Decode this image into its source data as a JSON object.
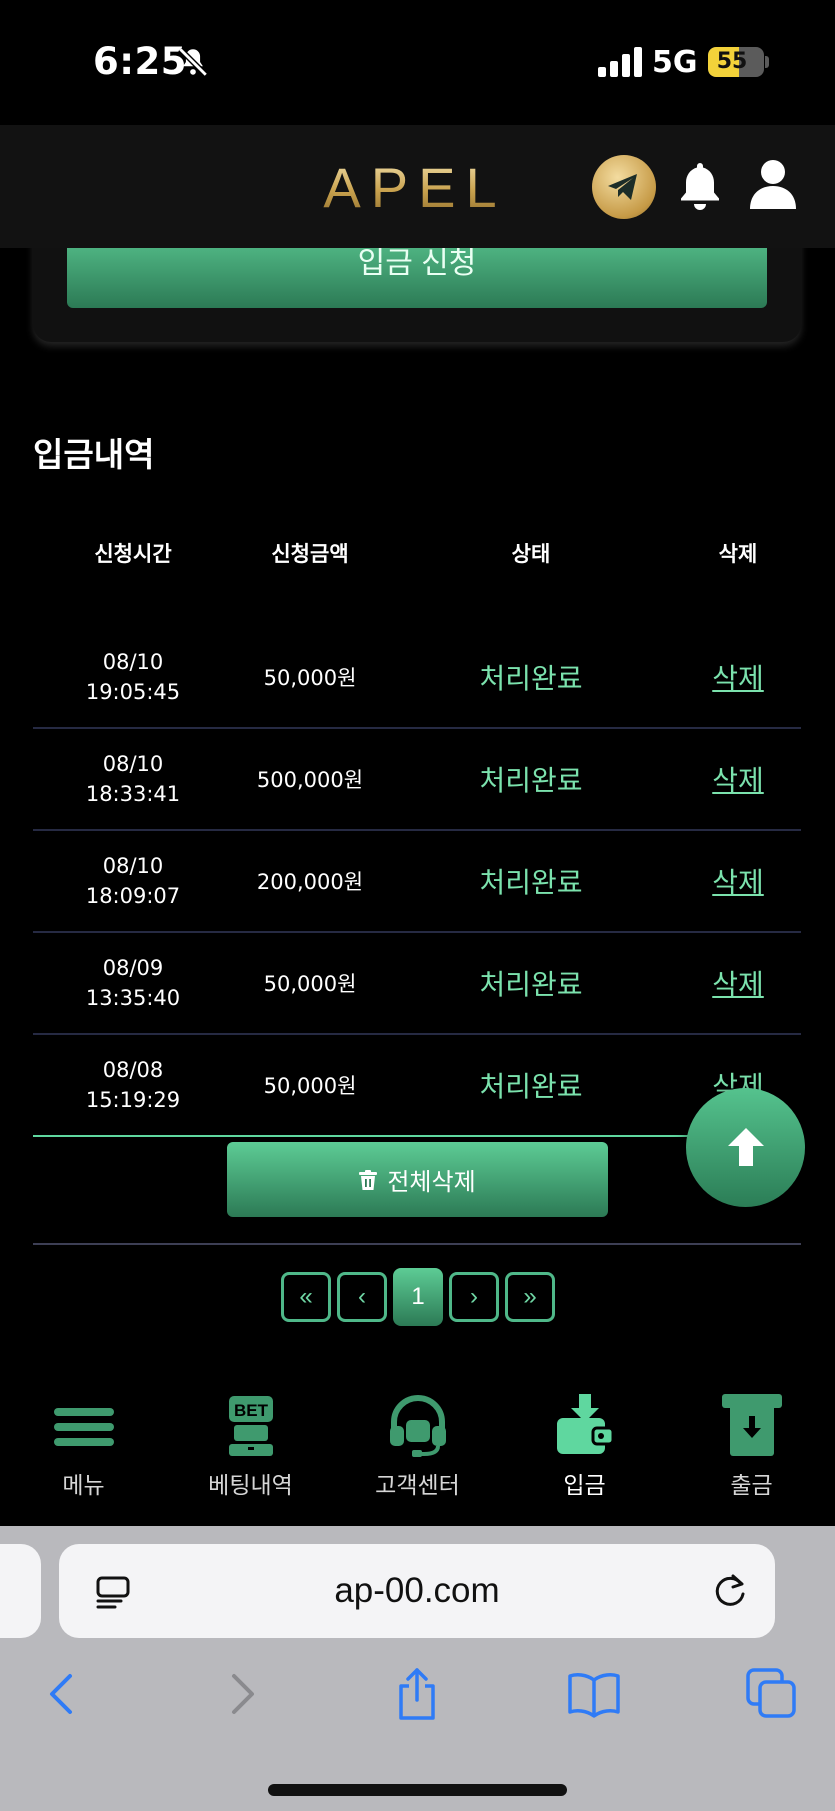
{
  "status_bar": {
    "time": "6:25",
    "network": "5G",
    "battery": "55",
    "battery_level": 0.55
  },
  "header": {
    "brand": "APEL"
  },
  "apply_button_label": "입금 신청",
  "section_title": "입금내역",
  "table": {
    "columns": [
      "신청시간",
      "신청금액",
      "상태",
      "삭제"
    ],
    "rows": [
      {
        "date": "08/10",
        "time": "19:05:45",
        "amount": "50,000원",
        "status": "처리완료",
        "action": "삭제"
      },
      {
        "date": "08/10",
        "time": "18:33:41",
        "amount": "500,000원",
        "status": "처리완료",
        "action": "삭제"
      },
      {
        "date": "08/10",
        "time": "18:09:07",
        "amount": "200,000원",
        "status": "처리완료",
        "action": "삭제"
      },
      {
        "date": "08/09",
        "time": "13:35:40",
        "amount": "50,000원",
        "status": "처리완료",
        "action": "삭제"
      },
      {
        "date": "08/08",
        "time": "15:19:29",
        "amount": "50,000원",
        "status": "처리완료",
        "action": "삭제"
      }
    ]
  },
  "delete_all_label": "전체삭제",
  "pagination": {
    "first": "«",
    "prev": "‹",
    "current": "1",
    "next": "›",
    "last": "»"
  },
  "bottom_nav": [
    {
      "label": "메뉴",
      "icon": "menu-icon"
    },
    {
      "label": "베팅내역",
      "icon": "bet-history-icon",
      "icon_text": "BET"
    },
    {
      "label": "고객센터",
      "icon": "headset-icon"
    },
    {
      "label": "입금",
      "icon": "deposit-icon",
      "active": true
    },
    {
      "label": "출금",
      "icon": "withdraw-icon"
    }
  ],
  "browser": {
    "url": "ap-00.com"
  },
  "colors": {
    "accent": "#5fd79f",
    "accent_dark": "#2c7a55",
    "gold": "#c9a24e"
  }
}
